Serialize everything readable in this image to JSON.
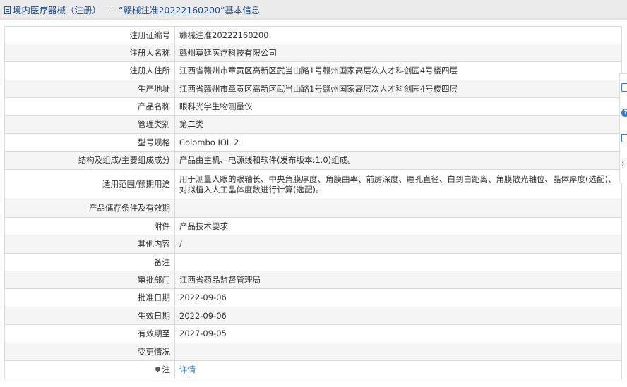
{
  "header": {
    "title": "境内医疗器械（注册）——“赣械注准20222160200”基本信息"
  },
  "rows": [
    {
      "label": "注册证编号",
      "value": "赣械注准20222160200"
    },
    {
      "label": "注册人名称",
      "value": "赣州莫廷医疗科技有限公司"
    },
    {
      "label": "注册人住所",
      "value": "江西省赣州市章贡区高新区武当山路1号赣州国家高层次人才科创园4号楼四层"
    },
    {
      "label": "生产地址",
      "value": "江西省赣州市章贡区高新区武当山路1号赣州国家高层次人才科创园4号楼四层"
    },
    {
      "label": "产品名称",
      "value": "眼科光学生物测量仪"
    },
    {
      "label": "管理类别",
      "value": "第二类"
    },
    {
      "label": "型号规格",
      "value": "Colombo IOL 2"
    },
    {
      "label": "结构及组成/主要组成成分",
      "value": "产品由主机、电源线和软件(发布版本:1.0)组成。"
    },
    {
      "label": "适用范围/预期用途",
      "value": "用于测量人眼的眼轴长、中央角膜厚度、角膜曲率、前房深度、瞳孔直径、白到白距离、角膜散光轴位、晶体厚度(选配)、对拟植入人工晶体度数进行计算(选配)。"
    },
    {
      "label": "产品储存条件及有效期",
      "value": ""
    },
    {
      "label": "附件",
      "value": "产品技术要求"
    },
    {
      "label": "其他内容",
      "value": "/"
    },
    {
      "label": "备注",
      "value": ""
    },
    {
      "label": "审批部门",
      "value": "江西省药品监督管理局"
    },
    {
      "label": "批准日期",
      "value": "2022-09-06"
    },
    {
      "label": "生效日期",
      "value": "2022-09-06"
    },
    {
      "label": "有效期至",
      "value": "2027-09-05"
    },
    {
      "label": "变更情况",
      "value": ""
    }
  ],
  "note": {
    "label": "注",
    "link_text": "详情"
  },
  "side_toolbar": {
    "icons": [
      "edit-icon",
      "help-icon",
      "copy-icon",
      "chevron-right-icon"
    ],
    "help_glyph": "?",
    "chevron_glyph": "›"
  },
  "colors": {
    "header_bg": "#ebebeb",
    "header_text": "#1b4e94",
    "row_alt_bg": "#f5f5f5",
    "border": "#d9d9d9",
    "link": "#1f6fbf"
  }
}
